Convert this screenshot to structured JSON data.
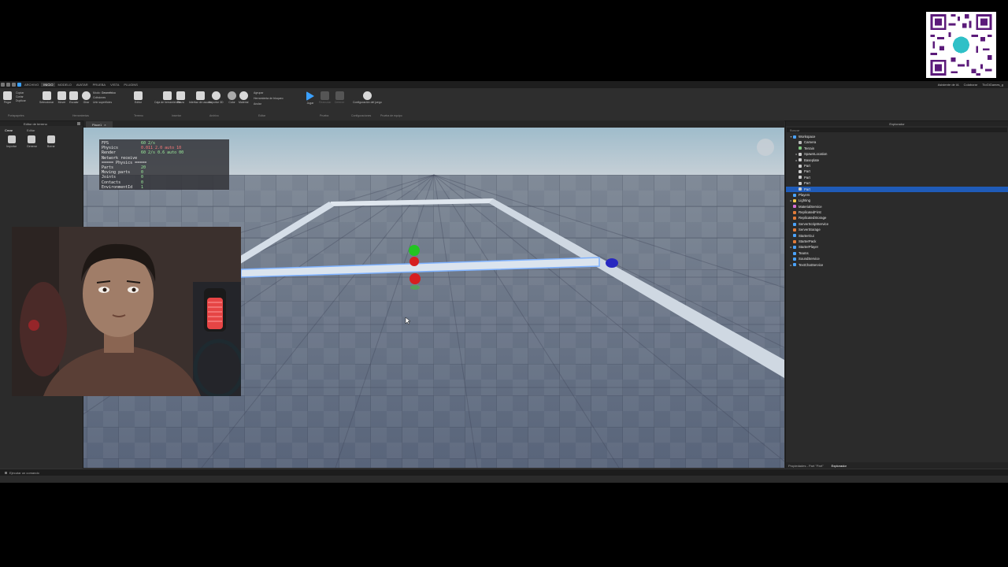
{
  "menubar": {
    "items": [
      {
        "label": "ARCHIVO",
        "active": false
      },
      {
        "label": "INICIO",
        "active": true
      },
      {
        "label": "MODELO",
        "active": false
      },
      {
        "label": "AVATAR",
        "active": false
      },
      {
        "label": "PRUEBA",
        "active": false
      },
      {
        "label": "VISTA",
        "active": false
      },
      {
        "label": "PLUGINS",
        "active": false
      }
    ],
    "right": [
      "Asistente de IA",
      "Colaborar",
      "TioGiGames_g"
    ]
  },
  "ribbon": {
    "clipboard": {
      "paste": "Pegar",
      "list": [
        "Copiar",
        "Cortar",
        "Duplicar"
      ],
      "group": "Portapapeles"
    },
    "tools": {
      "select": "Seleccionar",
      "move": "Mover",
      "scale": "Escalar",
      "rotate": "Girar",
      "mode_label": "Modo:",
      "mode_value": "Geométrico",
      "collisions": "Colisiones",
      "joins": "Unir superficies",
      "group": "Herramientas"
    },
    "terrain": {
      "editor": "Editor",
      "group": "Terreno"
    },
    "insert": {
      "toolbox": "Caja de herramientas",
      "part": "Pieza",
      "ui": "Interfaz de usuario",
      "group": "Insertar"
    },
    "file": {
      "import3d": "Importar 3D",
      "group": "Archivo"
    },
    "edit": {
      "color": "Color",
      "material": "Material",
      "group_btn": "Agrupar",
      "lock": "Herramienta de bloqueo",
      "anchor": "Anclar",
      "group": "Editar"
    },
    "test": {
      "play": "Jugar",
      "resume": "Reanudar",
      "stop": "Detener",
      "group": "Prueba"
    },
    "settings": {
      "game_settings": "Configuración del juego",
      "group": "Configuraciones"
    },
    "team_test": {
      "group": "Prueba de equipo"
    }
  },
  "left_panel": {
    "title": "Editor de terreno",
    "tabs": [
      {
        "label": "Crear",
        "active": true
      },
      {
        "label": "Editar",
        "active": false
      }
    ],
    "tools": [
      "Importar",
      "Generar",
      "Borrar"
    ]
  },
  "viewport_tab": {
    "label": "Place1"
  },
  "stats": [
    {
      "k": "FPS",
      "v": "60 2/s",
      "red": false
    },
    {
      "k": "Physics",
      "v": "0.011 2.0 auto 10",
      "red": true
    },
    {
      "k": "Render",
      "v": "60 2/s 0.6 auto 00",
      "red": false
    },
    {
      "k": "Network receive",
      "v": "",
      "red": false
    },
    {
      "k": "===== Physics =====",
      "v": "",
      "red": false
    },
    {
      "k": "Parts",
      "v": "20",
      "red": false
    },
    {
      "k": "Moving parts",
      "v": "0",
      "red": false
    },
    {
      "k": "Joints",
      "v": "0",
      "red": false
    },
    {
      "k": "Contacts",
      "v": "0",
      "red": false
    },
    {
      "k": "EnvironmentId",
      "v": "1",
      "red": false
    }
  ],
  "explorer": {
    "title": "Explorador",
    "filter_placeholder": "Buscar",
    "tree": [
      {
        "label": "Workspace",
        "depth": 0,
        "icon": "workspace-icon",
        "color": "#4aa3ff",
        "twisty": "▾",
        "selected": false
      },
      {
        "label": "Camera",
        "depth": 1,
        "icon": "camera-icon",
        "color": "#bbbbbb",
        "twisty": "",
        "selected": false
      },
      {
        "label": "Terrain",
        "depth": 1,
        "icon": "terrain-icon",
        "color": "#7fc97f",
        "twisty": "",
        "selected": false
      },
      {
        "label": "SpawnLocation",
        "depth": 1,
        "icon": "spawn-icon",
        "color": "#cccccc",
        "twisty": "▸",
        "selected": false
      },
      {
        "label": "Baseplate",
        "depth": 1,
        "icon": "part-icon",
        "color": "#cccccc",
        "twisty": "▸",
        "selected": false
      },
      {
        "label": "Part",
        "depth": 1,
        "icon": "part-icon",
        "color": "#cccccc",
        "twisty": "",
        "selected": false
      },
      {
        "label": "Part",
        "depth": 1,
        "icon": "part-icon",
        "color": "#cccccc",
        "twisty": "",
        "selected": false
      },
      {
        "label": "Part",
        "depth": 1,
        "icon": "part-icon",
        "color": "#cccccc",
        "twisty": "",
        "selected": false
      },
      {
        "label": "Part",
        "depth": 1,
        "icon": "part-icon",
        "color": "#cccccc",
        "twisty": "",
        "selected": false
      },
      {
        "label": "Part",
        "depth": 1,
        "icon": "part-icon",
        "color": "#cccccc",
        "twisty": "",
        "selected": true
      },
      {
        "label": "Players",
        "depth": 0,
        "icon": "players-icon",
        "color": "#4aa3ff",
        "twisty": "",
        "selected": false
      },
      {
        "label": "Lighting",
        "depth": 0,
        "icon": "lighting-icon",
        "color": "#f2c94c",
        "twisty": "▸",
        "selected": false
      },
      {
        "label": "MaterialService",
        "depth": 0,
        "icon": "service-icon",
        "color": "#d66fd6",
        "twisty": "",
        "selected": false
      },
      {
        "label": "ReplicatedFirst",
        "depth": 0,
        "icon": "service-icon",
        "color": "#e07b3a",
        "twisty": "",
        "selected": false
      },
      {
        "label": "ReplicatedStorage",
        "depth": 0,
        "icon": "service-icon",
        "color": "#e07b3a",
        "twisty": "",
        "selected": false
      },
      {
        "label": "ServerScriptService",
        "depth": 0,
        "icon": "service-icon",
        "color": "#4aa3ff",
        "twisty": "",
        "selected": false
      },
      {
        "label": "ServerStorage",
        "depth": 0,
        "icon": "service-icon",
        "color": "#e07b3a",
        "twisty": "",
        "selected": false
      },
      {
        "label": "StarterGui",
        "depth": 0,
        "icon": "service-icon",
        "color": "#4aa3ff",
        "twisty": "",
        "selected": false
      },
      {
        "label": "StarterPack",
        "depth": 0,
        "icon": "service-icon",
        "color": "#e07b3a",
        "twisty": "",
        "selected": false
      },
      {
        "label": "StarterPlayer",
        "depth": 0,
        "icon": "service-icon",
        "color": "#4aa3ff",
        "twisty": "▸",
        "selected": false
      },
      {
        "label": "Teams",
        "depth": 0,
        "icon": "service-icon",
        "color": "#4aa3ff",
        "twisty": "",
        "selected": false
      },
      {
        "label": "SoundService",
        "depth": 0,
        "icon": "service-icon",
        "color": "#4aa3ff",
        "twisty": "",
        "selected": false
      },
      {
        "label": "TextChatService",
        "depth": 0,
        "icon": "service-icon",
        "color": "#4aa3ff",
        "twisty": "▸",
        "selected": false
      }
    ],
    "footer_tabs": [
      {
        "label": "Propiedades - Part \"Part\"",
        "active": false
      },
      {
        "label": "Explorador",
        "active": true
      }
    ]
  },
  "command_bar": {
    "placeholder": "Ejecutar un comando"
  },
  "colors": {
    "accent": "#1f5bb8",
    "sky_top": "#a9c3cf",
    "floor": "#5e6a7c",
    "wall": "#d5dee8"
  }
}
